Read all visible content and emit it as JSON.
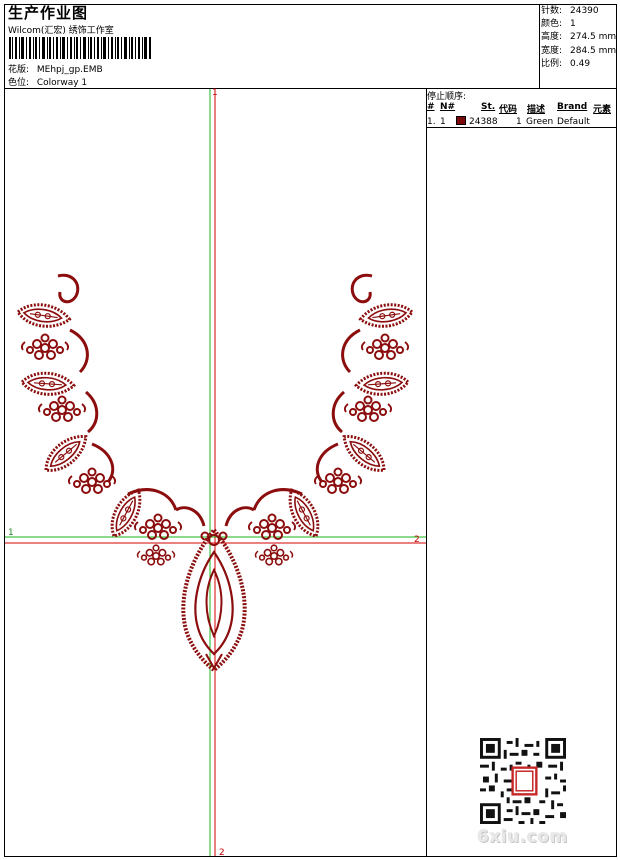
{
  "header": {
    "title": "生产作业图",
    "subtitle": "Wilcom(汇宏) 绣饰工作室",
    "design_label": "花版:",
    "design_value": "MEhpj_gp.EMB",
    "colorway_label": "色位:",
    "colorway_value": "Colorway 1"
  },
  "stats": {
    "stitches_label": "针数:",
    "stitches_value": "24390",
    "colors_label": "颜色:",
    "colors_value": "1",
    "height_label": "高度:",
    "height_value": "274.5 mm",
    "width_label": "宽度:",
    "width_value": "284.5 mm",
    "scale_label": "比例:",
    "scale_value": "0.49"
  },
  "stop_sequence": {
    "title": "停止顺序:",
    "headers": [
      "#",
      "N#",
      "St.",
      "代码",
      "描述",
      "Brand",
      "元素"
    ],
    "rows": [
      {
        "index": "1.",
        "n": "1",
        "swatch_color": "#7a0a0a",
        "stitches": "24388",
        "code": "1",
        "description": "Green",
        "brand": "Default"
      }
    ]
  },
  "axes": {
    "top_label": "1",
    "bottom_label": "2",
    "left_label": "1",
    "right_label": "2"
  },
  "watermark": {
    "text": "6xiu.com"
  },
  "colors": {
    "stitch": "#8b0d0d",
    "axis_red": "#d40000",
    "axis_green": "#19b419"
  }
}
